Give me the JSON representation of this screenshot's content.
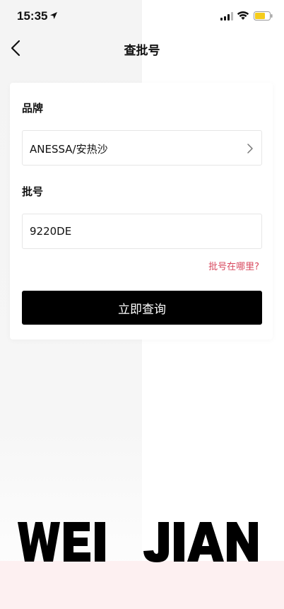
{
  "status_bar": {
    "time": "15:35"
  },
  "nav": {
    "title": "查批号"
  },
  "form": {
    "brand_label": "品牌",
    "brand_value": "ANESSA/安热沙",
    "batch_label": "批号",
    "batch_value": "9220DE",
    "help_link": "批号在哪里?",
    "submit_label": "立即查询"
  },
  "watermark": {
    "text": "WEI JIAN"
  },
  "colors": {
    "accent_link": "#d8485e",
    "button_bg": "#000000",
    "battery": "#f5cc1a"
  }
}
